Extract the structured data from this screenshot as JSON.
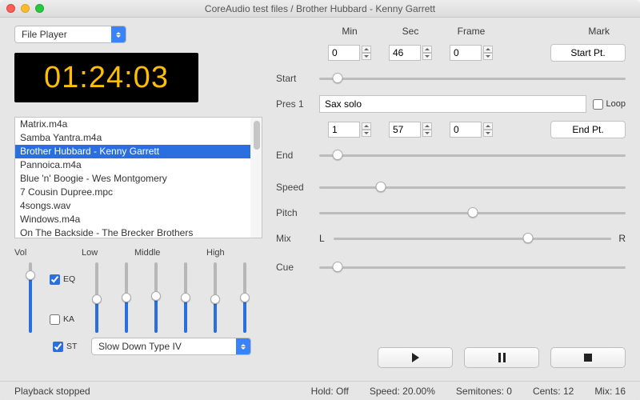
{
  "window": {
    "title": "CoreAudio test files / Brother Hubbard - Kenny Garrett"
  },
  "left": {
    "source_selector": "File Player",
    "time_display": "01:24:03",
    "playlist": [
      "Matrix.m4a",
      "Samba Yantra.m4a",
      "Brother Hubbard - Kenny Garrett",
      "Pannoica.m4a",
      "Blue 'n' Boogie - Wes Montgomery",
      "7 Cousin Dupree.mpc",
      "4songs.wav",
      "Windows.m4a",
      "On The Backside - The Brecker Brothers"
    ],
    "playlist_selected_index": 2,
    "eq_headers": {
      "vol": "Vol",
      "low": "Low",
      "mid": "Middle",
      "high": "High"
    },
    "eq_percent": [
      82,
      48,
      50,
      52,
      50,
      48,
      50
    ],
    "eq_checkbox_eq": "EQ",
    "eq_checkbox_ka": "KA",
    "st_checkbox": "ST",
    "slow_type": "Slow Down Type IV"
  },
  "right": {
    "hdr": {
      "min": "Min",
      "sec": "Sec",
      "frame": "Frame",
      "mark": "Mark"
    },
    "labels": {
      "start": "Start",
      "pres": "Pres 1",
      "end": "End",
      "speed": "Speed",
      "pitch": "Pitch",
      "mix": "Mix",
      "cue": "Cue",
      "l": "L",
      "r": "R",
      "loop": "Loop"
    },
    "start": {
      "min": "0",
      "sec": "46",
      "frame": "0"
    },
    "end": {
      "min": "1",
      "sec": "57",
      "frame": "0"
    },
    "start_pt_btn": "Start Pt.",
    "end_pt_btn": "End Pt.",
    "preset_name": "Sax solo",
    "sliders": {
      "start": 6,
      "end": 6,
      "speed": 20,
      "pitch": 50,
      "mix": 70,
      "cue": 6
    }
  },
  "status": {
    "playback": "Playback stopped",
    "hold": "Hold: Off",
    "speed": "Speed: 20.00%",
    "semitones": "Semitones: 0",
    "cents": "Cents: 12",
    "mix": "Mix: 16"
  }
}
